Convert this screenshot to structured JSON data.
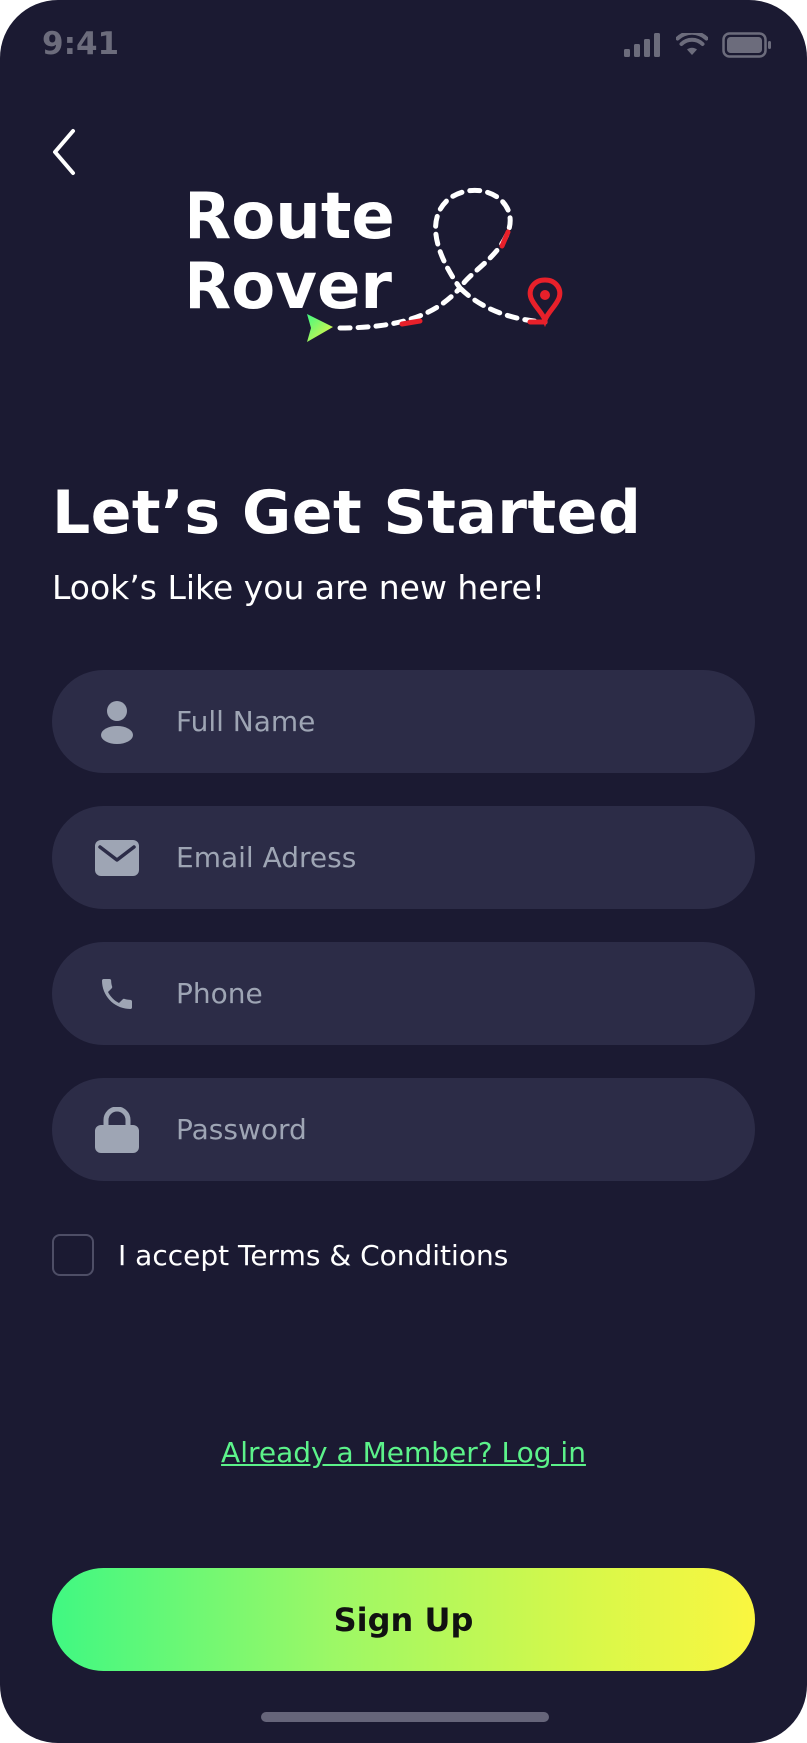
{
  "status_bar": {
    "time": "9:41"
  },
  "logo": {
    "line1": "Route",
    "line2": "Rover"
  },
  "header": {
    "title": "Let’s Get Started",
    "subtitle": "Look’s Like you are new here!"
  },
  "form": {
    "full_name": {
      "placeholder": "Full Name",
      "value": ""
    },
    "email": {
      "placeholder": "Email Adress",
      "value": ""
    },
    "phone": {
      "placeholder": "Phone",
      "value": ""
    },
    "password": {
      "placeholder": "Password",
      "value": ""
    },
    "terms_label": "I accept Terms & Conditions",
    "terms_checked": false
  },
  "login_link": "Already a Member? Log in",
  "signup_button": "Sign Up",
  "colors": {
    "background": "#1b1a32",
    "field_background": "#2c2c47",
    "link": "#5cf28a",
    "button_gradient_start": "#40f882",
    "button_gradient_end": "#faf640",
    "accent_red": "#e8202a"
  },
  "icons": [
    "back-chevron-icon",
    "signal-icon",
    "wifi-icon",
    "battery-icon",
    "user-icon",
    "mail-icon",
    "phone-icon",
    "lock-icon",
    "map-pin-icon",
    "arrow-play-icon"
  ]
}
